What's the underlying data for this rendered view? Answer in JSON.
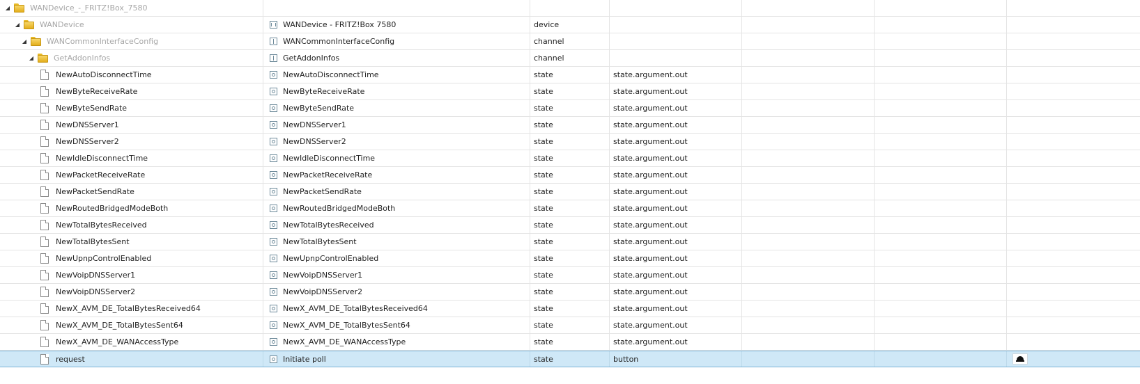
{
  "rows": [
    {
      "id": "WANDevice_-_FRITZ!Box_7580",
      "name": "",
      "type": "",
      "role": "",
      "kind": "folder",
      "indent": 0,
      "muted": true,
      "icon": ""
    },
    {
      "id": "WANDevice",
      "name": "WANDevice - FRITZ!Box 7580",
      "type": "device",
      "role": "",
      "kind": "folder",
      "indent": 1,
      "muted": true,
      "icon": "device"
    },
    {
      "id": "WANCommonInterfaceConfig",
      "name": "WANCommonInterfaceConfig",
      "type": "channel",
      "role": "",
      "kind": "folder",
      "indent": 2,
      "muted": true,
      "icon": "channel"
    },
    {
      "id": "GetAddonInfos",
      "name": "GetAddonInfos",
      "type": "channel",
      "role": "",
      "kind": "folder",
      "indent": 3,
      "muted": true,
      "icon": "channel"
    },
    {
      "id": "NewAutoDisconnectTime",
      "name": "NewAutoDisconnectTime",
      "type": "state",
      "role": "state.argument.out",
      "kind": "file",
      "icon": "state"
    },
    {
      "id": "NewByteReceiveRate",
      "name": "NewByteReceiveRate",
      "type": "state",
      "role": "state.argument.out",
      "kind": "file",
      "icon": "state"
    },
    {
      "id": "NewByteSendRate",
      "name": "NewByteSendRate",
      "type": "state",
      "role": "state.argument.out",
      "kind": "file",
      "icon": "state"
    },
    {
      "id": "NewDNSServer1",
      "name": "NewDNSServer1",
      "type": "state",
      "role": "state.argument.out",
      "kind": "file",
      "icon": "state"
    },
    {
      "id": "NewDNSServer2",
      "name": "NewDNSServer2",
      "type": "state",
      "role": "state.argument.out",
      "kind": "file",
      "icon": "state"
    },
    {
      "id": "NewIdleDisconnectTime",
      "name": "NewIdleDisconnectTime",
      "type": "state",
      "role": "state.argument.out",
      "kind": "file",
      "icon": "state"
    },
    {
      "id": "NewPacketReceiveRate",
      "name": "NewPacketReceiveRate",
      "type": "state",
      "role": "state.argument.out",
      "kind": "file",
      "icon": "state"
    },
    {
      "id": "NewPacketSendRate",
      "name": "NewPacketSendRate",
      "type": "state",
      "role": "state.argument.out",
      "kind": "file",
      "icon": "state"
    },
    {
      "id": "NewRoutedBridgedModeBoth",
      "name": "NewRoutedBridgedModeBoth",
      "type": "state",
      "role": "state.argument.out",
      "kind": "file",
      "icon": "state"
    },
    {
      "id": "NewTotalBytesReceived",
      "name": "NewTotalBytesReceived",
      "type": "state",
      "role": "state.argument.out",
      "kind": "file",
      "icon": "state"
    },
    {
      "id": "NewTotalBytesSent",
      "name": "NewTotalBytesSent",
      "type": "state",
      "role": "state.argument.out",
      "kind": "file",
      "icon": "state"
    },
    {
      "id": "NewUpnpControlEnabled",
      "name": "NewUpnpControlEnabled",
      "type": "state",
      "role": "state.argument.out",
      "kind": "file",
      "icon": "state"
    },
    {
      "id": "NewVoipDNSServer1",
      "name": "NewVoipDNSServer1",
      "type": "state",
      "role": "state.argument.out",
      "kind": "file",
      "icon": "state"
    },
    {
      "id": "NewVoipDNSServer2",
      "name": "NewVoipDNSServer2",
      "type": "state",
      "role": "state.argument.out",
      "kind": "file",
      "icon": "state"
    },
    {
      "id": "NewX_AVM_DE_TotalBytesReceived64",
      "name": "NewX_AVM_DE_TotalBytesReceived64",
      "type": "state",
      "role": "state.argument.out",
      "kind": "file",
      "icon": "state"
    },
    {
      "id": "NewX_AVM_DE_TotalBytesSent64",
      "name": "NewX_AVM_DE_TotalBytesSent64",
      "type": "state",
      "role": "state.argument.out",
      "kind": "file",
      "icon": "state"
    },
    {
      "id": "NewX_AVM_DE_WANAccessType",
      "name": "NewX_AVM_DE_WANAccessType",
      "type": "state",
      "role": "state.argument.out",
      "kind": "file",
      "icon": "state"
    },
    {
      "id": "request",
      "name": "Initiate poll",
      "type": "state",
      "role": "button",
      "kind": "file",
      "icon": "state",
      "selected": true,
      "action_icon": "bell-icon"
    }
  ]
}
